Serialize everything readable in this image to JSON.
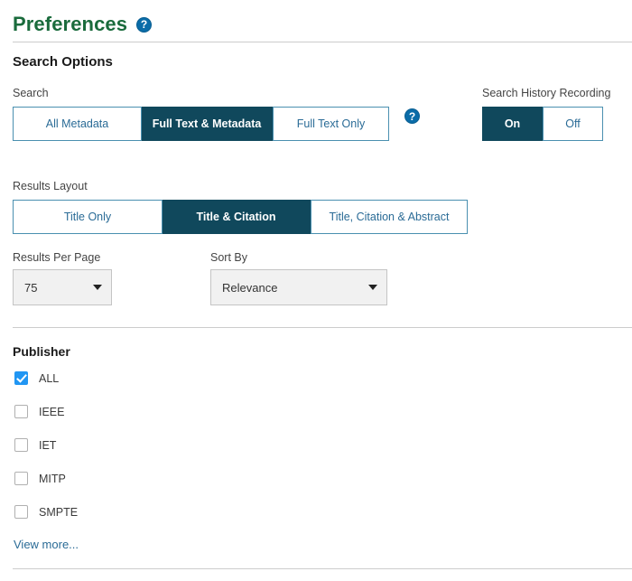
{
  "header": {
    "title": "Preferences",
    "help_icon": "help-circle-icon",
    "help_glyph": "?"
  },
  "sections": {
    "search_options_heading": "Search Options",
    "publisher_heading": "Publisher"
  },
  "search": {
    "label": "Search",
    "options": [
      "All Metadata",
      "Full Text & Metadata",
      "Full Text Only"
    ],
    "selected": "Full Text & Metadata",
    "help_icon": "help-circle-icon",
    "help_glyph": "?"
  },
  "search_history": {
    "label": "Search History Recording",
    "options": [
      "On",
      "Off"
    ],
    "selected": "On"
  },
  "results_layout": {
    "label": "Results Layout",
    "options": [
      "Title Only",
      "Title & Citation",
      "Title, Citation & Abstract"
    ],
    "selected": "Title & Citation"
  },
  "results_per_page": {
    "label": "Results Per Page",
    "value": "75",
    "caret_icon": "chevron-down-icon"
  },
  "sort_by": {
    "label": "Sort By",
    "value": "Relevance",
    "caret_icon": "chevron-down-icon"
  },
  "publisher": {
    "items": [
      {
        "label": "ALL",
        "checked": true
      },
      {
        "label": "IEEE",
        "checked": false
      },
      {
        "label": "IET",
        "checked": false
      },
      {
        "label": "MITP",
        "checked": false
      },
      {
        "label": "SMPTE",
        "checked": false
      }
    ],
    "view_more": "View more..."
  },
  "colors": {
    "title_green": "#1a6b3c",
    "selected_navy": "#10485c",
    "link_blue": "#2a6b96",
    "help_blue": "#0a6ca8",
    "checkbox_blue": "#2196f3",
    "divider_gray": "#cccccc",
    "select_bg": "#f1f1f1"
  }
}
